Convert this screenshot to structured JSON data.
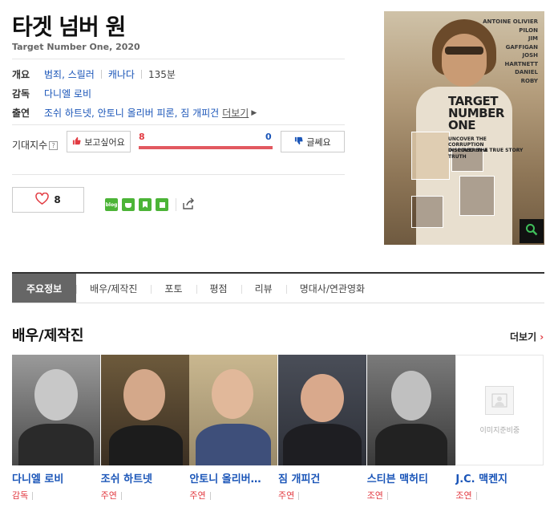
{
  "movie": {
    "title": "타겟 넘버 원",
    "subtitle": "Target Number One, 2020"
  },
  "info": {
    "overview_label": "개요",
    "genre": "범죄, 스릴러",
    "country": "캐나다",
    "runtime": "135분",
    "director_label": "감독",
    "director": "다니엘 로비",
    "cast_label": "출연",
    "cast": "조쉬 하트넷, 안토니 올리버 피론, 짐 개피건",
    "more": "더보기"
  },
  "expectation": {
    "label": "기대지수",
    "help": "?",
    "want_label": "보고싶어요",
    "want_count": "8",
    "dislike_label": "글쎄요",
    "dislike_count": "0",
    "want_ratio": 1.0
  },
  "like": {
    "count": "8"
  },
  "share_icons": [
    "blog",
    "cafe",
    "bookmark",
    "memo"
  ],
  "poster": {
    "names": [
      "ANTOINE OLIVIER",
      "PILON",
      "JIM",
      "GAFFIGAN",
      "JOSH",
      "HARTNETT",
      "DANIEL",
      "ROBY"
    ],
    "title_lines": [
      "TARGET",
      "NUMBER",
      "ONE"
    ],
    "tagline": "UNCOVER THE CORRUPTION DISCOVER THE TRUTH",
    "inspired": "INSPIRED BY A TRUE STORY"
  },
  "tabs": [
    "주요정보",
    "배우/제작진",
    "포토",
    "평점",
    "리뷰",
    "명대사/연관영화"
  ],
  "section": {
    "title": "배우/제작진",
    "more": "더보기"
  },
  "cast_list": [
    {
      "name": "다니엘 로비",
      "role": "감독"
    },
    {
      "name": "조쉬 하트넷",
      "role": "주연"
    },
    {
      "name": "안토니 올리버…",
      "role": "주연"
    },
    {
      "name": "짐 개피건",
      "role": "주연"
    },
    {
      "name": "스티븐 맥허티",
      "role": "조연"
    },
    {
      "name": "J.C. 맥켄지",
      "role": "조연"
    }
  ],
  "no_image_text": "이미지준비중",
  "colors": {
    "accent": "#e23b42",
    "link": "#1a55b8",
    "tab_active": "#666666"
  }
}
